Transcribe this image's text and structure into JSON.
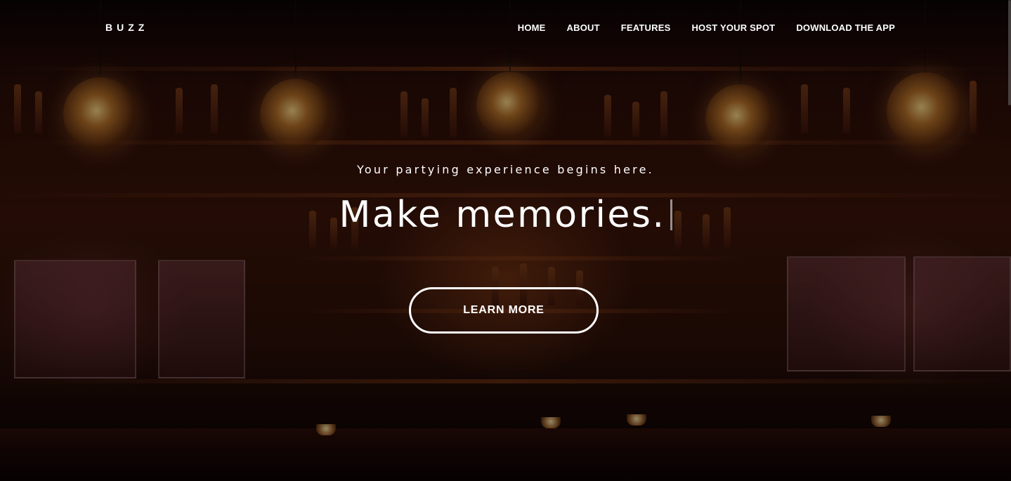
{
  "navbar": {
    "logo": "BUZZ",
    "links": [
      {
        "label": "HOME"
      },
      {
        "label": "ABOUT"
      },
      {
        "label": "FEATURES"
      },
      {
        "label": "HOST YOUR SPOT"
      },
      {
        "label": "DOWNLOAD THE APP"
      }
    ]
  },
  "hero": {
    "tagline": "Your partying experience begins here.",
    "headline": "Make memories.",
    "cta_label": "LEARN MORE",
    "background_description_icon": "bar-interior-photo"
  },
  "colors": {
    "text": "#ffffff",
    "overlay": "#000000"
  }
}
